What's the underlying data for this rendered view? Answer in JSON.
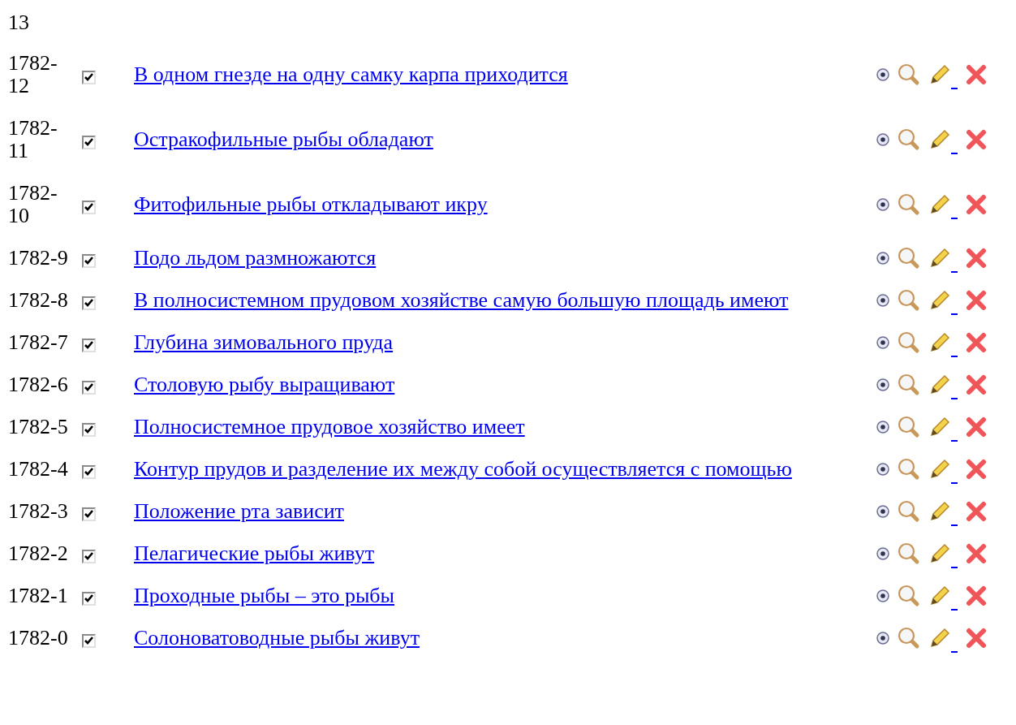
{
  "page_number": "13",
  "questions": [
    {
      "id": "1782-12",
      "checked": true,
      "title": "В одном гнезде на одну самку карпа приходится"
    },
    {
      "id": "1782-11",
      "checked": true,
      "title": "Остракофильные рыбы обладают"
    },
    {
      "id": "1782-10",
      "checked": true,
      "title": "Фитофильные рыбы откладывают икру"
    },
    {
      "id": "1782-9",
      "checked": true,
      "title": "Подо льдом размножаются"
    },
    {
      "id": "1782-8",
      "checked": true,
      "title": "В полносистемном прудовом хозяйстве самую большую площадь имеют"
    },
    {
      "id": "1782-7",
      "checked": true,
      "title": "Глубина зимовального пруда"
    },
    {
      "id": "1782-6",
      "checked": true,
      "title": "Столовую рыбу выращивают"
    },
    {
      "id": "1782-5",
      "checked": true,
      "title": "Полносистемное прудовое хозяйство имеет"
    },
    {
      "id": "1782-4",
      "checked": true,
      "title": "Контур прудов и разделение их между собой осуществляется с помощью"
    },
    {
      "id": "1782-3",
      "checked": true,
      "title": "Положение рта зависит"
    },
    {
      "id": "1782-2",
      "checked": true,
      "title": "Пелагические рыбы живут"
    },
    {
      "id": "1782-1",
      "checked": true,
      "title": "Проходные рыбы – это рыбы"
    },
    {
      "id": "1782-0",
      "checked": true,
      "title": "Солоноватоводные рыбы живут"
    }
  ]
}
